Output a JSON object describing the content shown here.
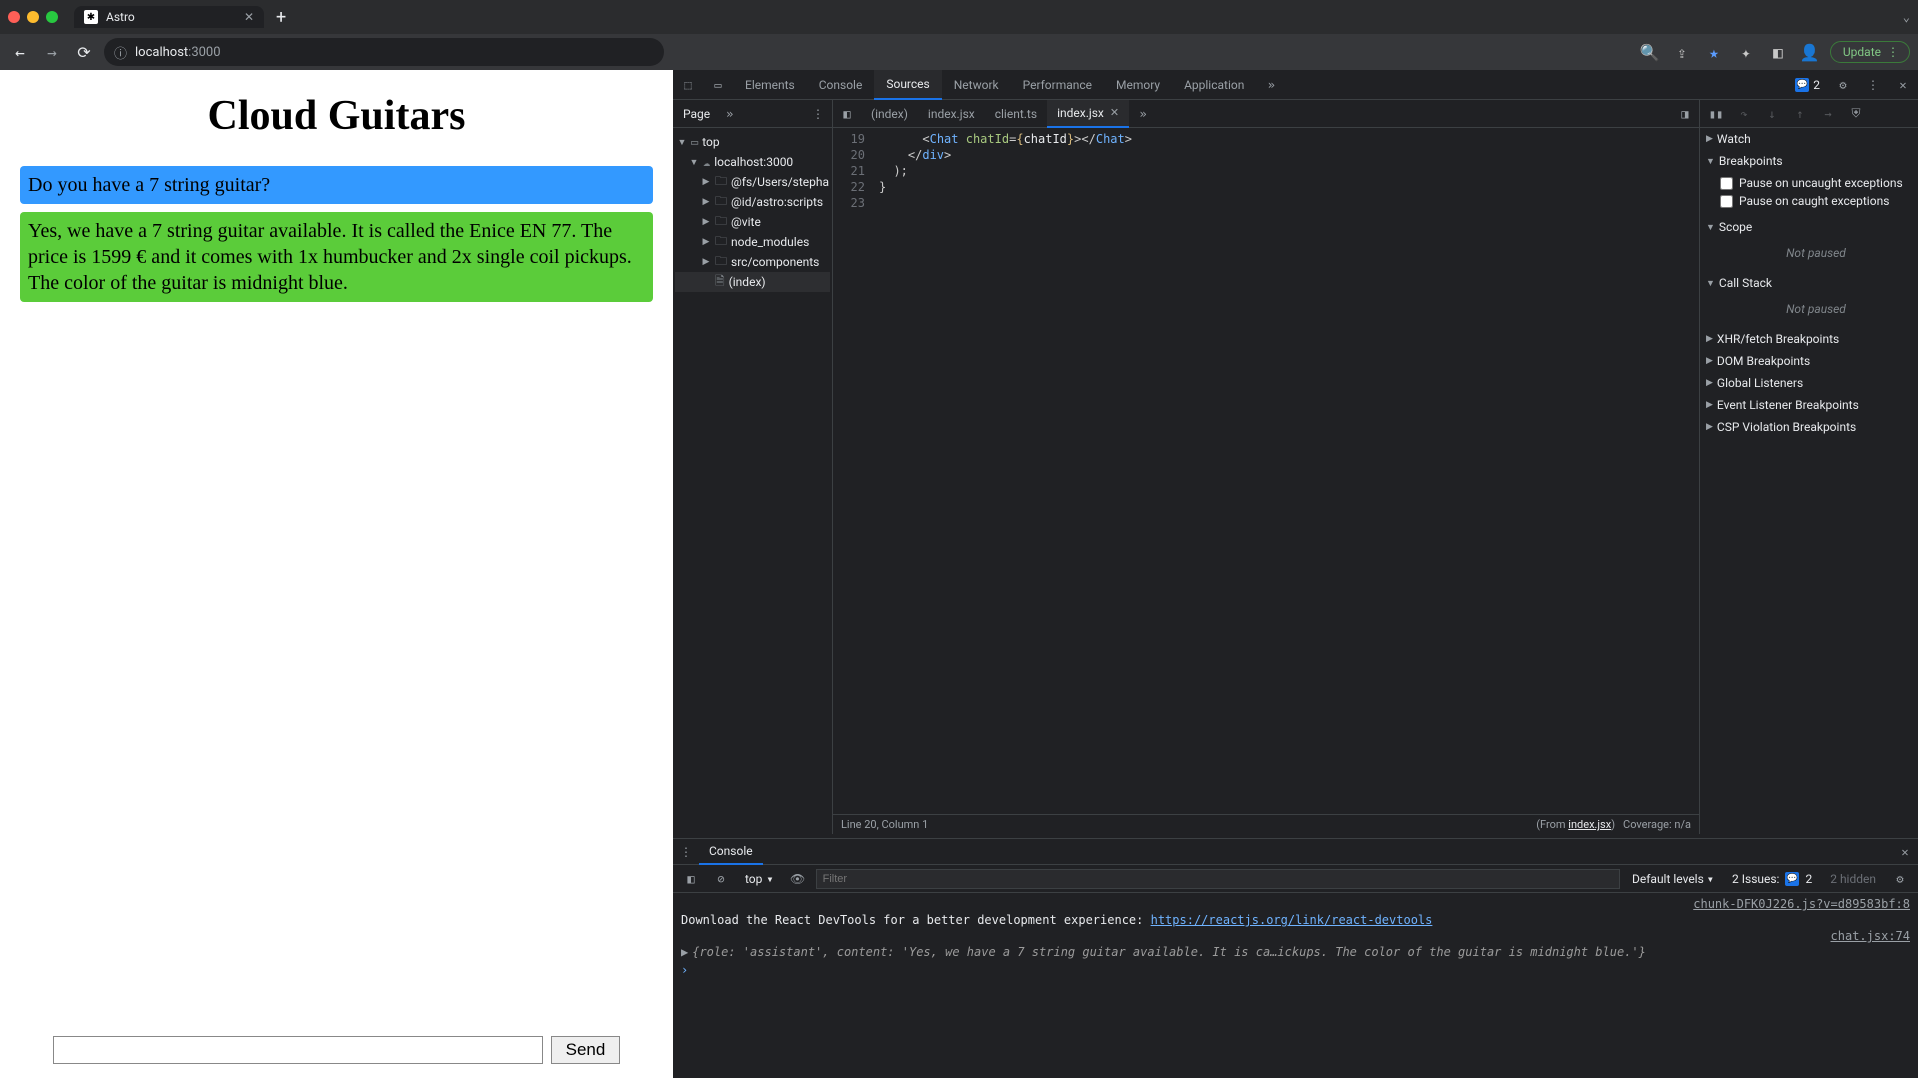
{
  "browser": {
    "tab_title": "Astro",
    "url_host": "localhost",
    "url_port": ":3000",
    "update_label": "Update"
  },
  "page": {
    "title": "Cloud Guitars",
    "messages": [
      {
        "role": "user",
        "text": "Do you have a 7 string guitar?"
      },
      {
        "role": "assistant",
        "text": "Yes, we have a 7 string guitar available. It is called the Enice EN 77. The price is 1599 € and it comes with 1x humbucker and 2x single coil pickups. The color of the guitar is midnight blue."
      }
    ],
    "send_label": "Send",
    "input_value": ""
  },
  "devtools": {
    "tabs": [
      "Elements",
      "Console",
      "Sources",
      "Network",
      "Performance",
      "Memory",
      "Application"
    ],
    "active_tab": "Sources",
    "issue_count": "2",
    "navigator": {
      "page_label": "Page",
      "tree": {
        "top": "top",
        "origin": "localhost:3000",
        "folders": [
          "@fs/Users/stepha",
          "@id/astro:scripts",
          "@vite",
          "node_modules",
          "src/components"
        ],
        "file": "(index)"
      }
    },
    "editor": {
      "tabs": [
        "(index)",
        "index.jsx",
        "client.ts",
        "index.jsx"
      ],
      "active_index": 3,
      "gutter": [
        "19",
        "20",
        "21",
        "22",
        "23"
      ],
      "code": [
        {
          "indent": 6,
          "html": "<span class='tok-punc'>&lt;</span><span class='tok-tag'>Chat</span> <span class='tok-attr'>chatId</span><span class='tok-punc'>=</span><span class='tok-brace'>{</span>chatId<span class='tok-brace'>}</span><span class='tok-punc'>&gt;&lt;/</span><span class='tok-tag'>Chat</span><span class='tok-punc'>&gt;</span>"
        },
        {
          "indent": 4,
          "html": "<span class='tok-punc'>&lt;/</span><span class='tok-tag'>div</span><span class='tok-punc'>&gt;</span>"
        },
        {
          "indent": 2,
          "html": "<span class='tok-punc'>);</span>"
        },
        {
          "indent": 0,
          "html": "<span class='tok-punc'>}</span>"
        },
        {
          "indent": 0,
          "html": ""
        }
      ],
      "status_left": "Line 20, Column 1",
      "status_from_pre": "(From ",
      "status_from_link": "index.jsx",
      "status_from_post": ")",
      "status_cov": "Coverage: n/a"
    },
    "debugger": {
      "panes": {
        "watch": "Watch",
        "breakpoints": "Breakpoints",
        "bp_uncaught": "Pause on uncaught exceptions",
        "bp_caught": "Pause on caught exceptions",
        "scope": "Scope",
        "scope_state": "Not paused",
        "callstack": "Call Stack",
        "callstack_state": "Not paused",
        "xhr": "XHR/fetch Breakpoints",
        "dom": "DOM Breakpoints",
        "gl": "Global Listeners",
        "el": "Event Listener Breakpoints",
        "csp": "CSP Violation Breakpoints"
      }
    },
    "console": {
      "tab": "Console",
      "context": "top",
      "filter_placeholder": "Filter",
      "levels": "Default levels",
      "issues_label": "2 Issues:",
      "issues_count": "2",
      "hidden": "2 hidden",
      "src1": "chunk-DFK0J226.js?v=d89583bf:8",
      "line1_pre": "Download the React DevTools for a better development experience: ",
      "line1_link": "https://reactjs.org/link/react-devtools",
      "src2": "chat.jsx:74",
      "obj": "{role: 'assistant', content: 'Yes, we have a 7 string guitar available. It is ca…ickups. The color of the guitar is midnight blue.'}"
    }
  }
}
